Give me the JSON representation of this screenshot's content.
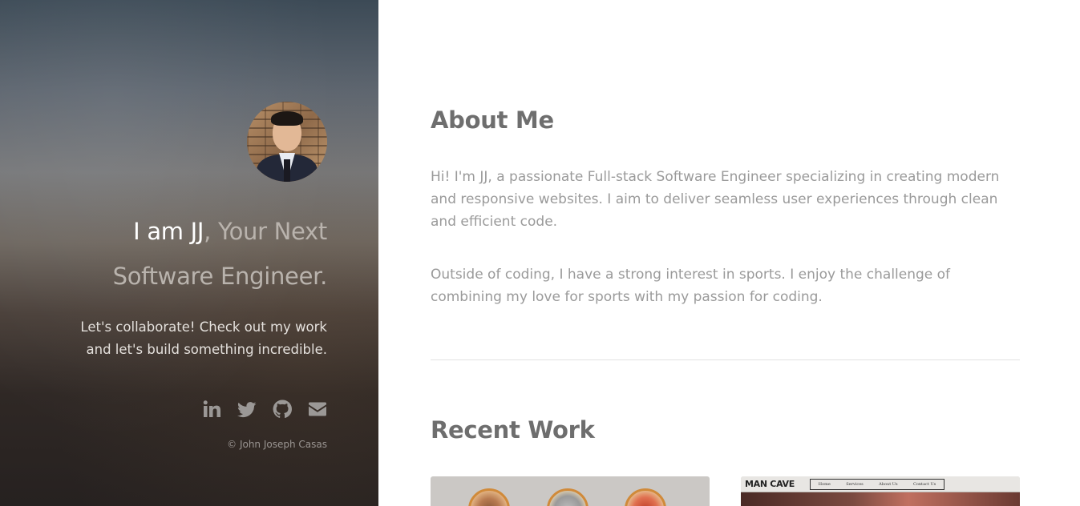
{
  "sidebar": {
    "avatar_alt": "Portrait of John Joseph Casas",
    "headline_highlight": "I am JJ",
    "headline_rest_1": ", Your Next",
    "headline_rest_2": "Software Engineer.",
    "tagline_line_1": "Let's collaborate! Check out my work",
    "tagline_line_2": "and let's build something incredible.",
    "socials": [
      {
        "name": "linkedin-icon"
      },
      {
        "name": "twitter-icon"
      },
      {
        "name": "github-icon"
      },
      {
        "name": "email-icon"
      }
    ],
    "copyright": "© John Joseph Casas"
  },
  "main": {
    "about_title": "About Me",
    "about_p1": "Hi! I'm JJ, a passionate Full-stack Software Engineer specializing in creating modern and responsive websites. I aim to deliver seamless user experiences through clean and efficient code.",
    "about_p2": "Outside of coding, I have a strong interest in sports. I enjoy the challenge of combining my love for sports with my passion for coding.",
    "work_title": "Recent Work",
    "projects": [
      {
        "name": "food-project-thumbnail"
      },
      {
        "name": "man-cave-project-thumbnail",
        "logo": "MAN CAVE",
        "nav": [
          "Home",
          "Services",
          "About Us",
          "Contact Us"
        ]
      }
    ]
  },
  "colors": {
    "headline_highlight": "#ffffff",
    "headline_muted": "#b9b3ad",
    "body_text": "#9a9a9a",
    "title_text": "#6e6e6e",
    "icon": "#9b9896"
  }
}
